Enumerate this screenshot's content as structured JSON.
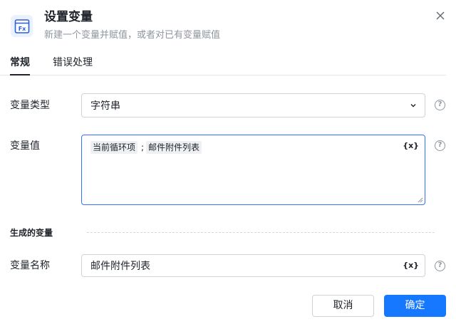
{
  "dialog": {
    "title": "设置变量",
    "subtitle": "新建一个变量并赋值，或者对已有变量赋值",
    "icon": "fx-variable-icon",
    "accent_color": "#1677ff"
  },
  "tabs": [
    {
      "label": "常规",
      "active": true
    },
    {
      "label": "错误处理",
      "active": false
    }
  ],
  "fields": {
    "variable_type": {
      "label": "变量类型",
      "value": "字符串"
    },
    "variable_value": {
      "label": "变量值",
      "tokens": [
        "当前循环项",
        "邮件附件列表"
      ],
      "separator": ";",
      "fx_label": "{x}"
    },
    "section_title": "生成的变量",
    "variable_name": {
      "label": "变量名称",
      "value": "邮件附件列表",
      "fx_label": "{x}"
    }
  },
  "help_glyph": "?",
  "buttons": {
    "cancel": "取消",
    "ok": "确定"
  }
}
